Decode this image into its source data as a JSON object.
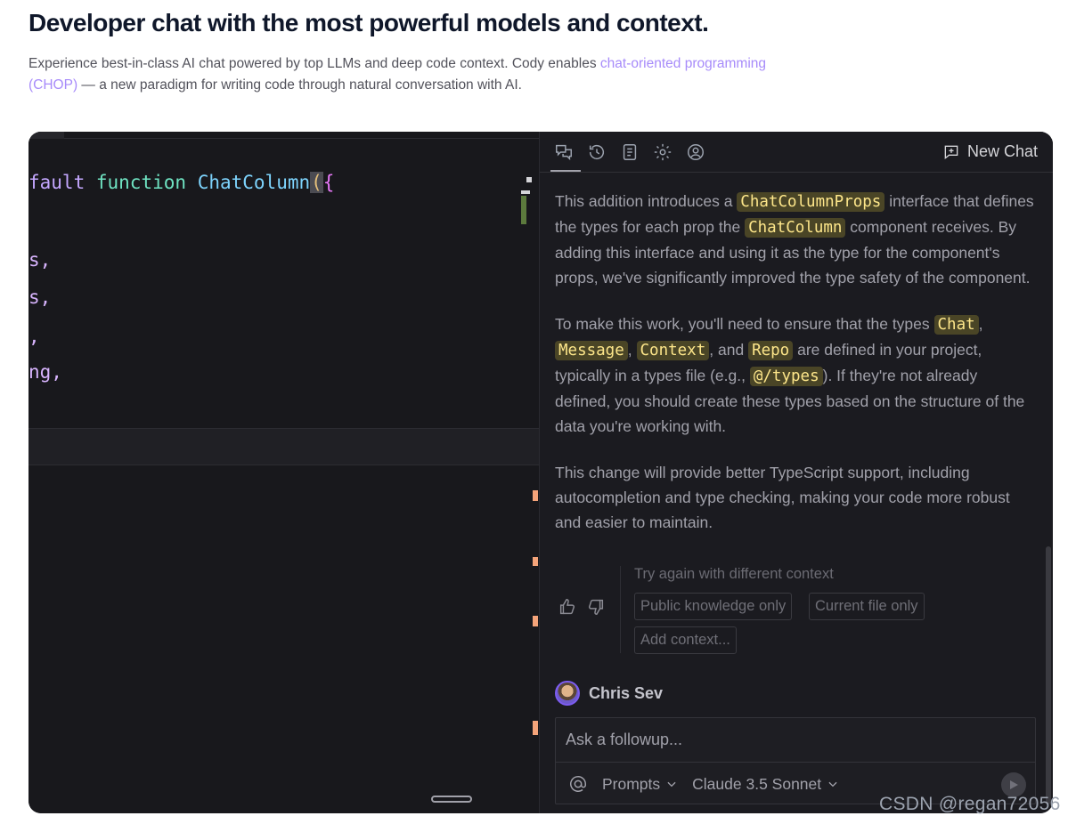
{
  "header": {
    "title": "Developer chat with the most powerful models and context.",
    "intro_before": "Experience best-in-class AI chat powered by top LLMs and deep code context. Cody enables ",
    "intro_link": "chat-oriented programming (CHOP)",
    "intro_after": " — a new paradigm for writing code through natural conversation with AI."
  },
  "editor": {
    "line1": {
      "kw": "fault",
      "fn": "function",
      "name": "ChatColumn",
      "paren": "(",
      "brace": "{"
    },
    "lines": [
      "s,",
      "s,",
      ",",
      "ng,"
    ]
  },
  "chat": {
    "toolbar": {
      "icons": [
        "chat-icon",
        "history-icon",
        "prompts-library-icon",
        "settings-icon",
        "account-icon"
      ],
      "new_chat": "New Chat"
    },
    "p1": {
      "a": "This addition introduces a ",
      "chip1": "ChatColumnProps",
      "b": " interface that defines the types for each prop the ",
      "chip2": "ChatColumn",
      "c": " component receives. By adding this interface and using it as the type for the component's props, we've significantly improved the type safety of the component."
    },
    "p2": {
      "a": "To make this work, you'll need to ensure that the types ",
      "chip1": "Chat",
      "b": ", ",
      "chip2": "Message",
      "c": ", ",
      "chip3": "Context",
      "d": ", and ",
      "chip4": "Repo",
      "e": " are defined in your project, typically in a types file (e.g., ",
      "chip5": "@/types",
      "f": "). If they're not already defined, you should create these types based on the structure of the data you're working with."
    },
    "p3": "This change will provide better TypeScript support, including autocompletion and type checking, making your code more robust and easier to maintain.",
    "retry_label": "Try again with different context",
    "context_buttons": [
      "Public knowledge only",
      "Current file only",
      "Add context..."
    ],
    "author": "Chris Sev",
    "input_placeholder": "Ask a followup...",
    "prompts_label": "Prompts",
    "model_label": "Claude 3.5 Sonnet"
  },
  "watermark": "CSDN @regan72056"
}
